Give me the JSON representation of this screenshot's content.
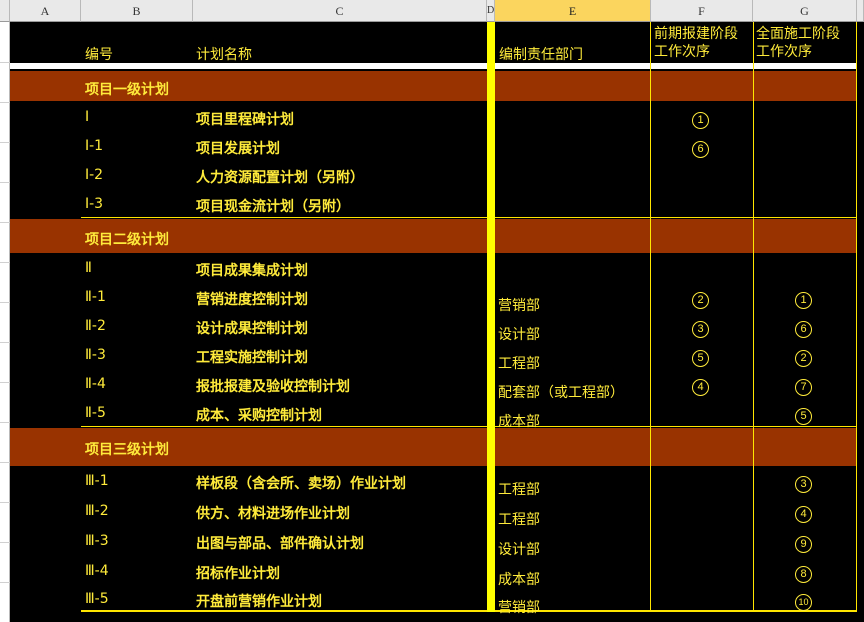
{
  "columns": [
    "A",
    "B",
    "C",
    "D",
    "E",
    "F",
    "G"
  ],
  "headers": {
    "num": "编号",
    "name": "计划名称",
    "dept": "编制责任部门",
    "phase1_line1": "前期报建阶段",
    "phase1_line2": "工作次序",
    "phase2_line1": "全面施工阶段",
    "phase2_line2": "工作次序"
  },
  "sections": [
    {
      "title": "项目一级计划"
    },
    {
      "title": "项目二级计划"
    },
    {
      "title": "项目三级计划"
    }
  ],
  "rows": [
    {
      "num": "Ⅰ",
      "name": "项目里程碑计划",
      "dept": "",
      "f": "1",
      "g": ""
    },
    {
      "num": "Ⅰ-1",
      "name": "项目发展计划",
      "dept": "",
      "f": "6",
      "g": ""
    },
    {
      "num": "Ⅰ-2",
      "name": "人力资源配置计划（另附）",
      "dept": "",
      "f": "",
      "g": ""
    },
    {
      "num": "Ⅰ-3",
      "name": "项目现金流计划（另附）",
      "dept": "",
      "f": "",
      "g": ""
    },
    {
      "num": "Ⅱ",
      "name": "项目成果集成计划",
      "dept": "",
      "f": "",
      "g": ""
    },
    {
      "num": "Ⅱ-1",
      "name": "营销进度控制计划",
      "dept": "营销部",
      "f": "2",
      "g": "1"
    },
    {
      "num": "Ⅱ-2",
      "name": "设计成果控制计划",
      "dept": "设计部",
      "f": "3",
      "g": "6"
    },
    {
      "num": "Ⅱ-3",
      "name": "工程实施控制计划",
      "dept": "工程部",
      "f": "5",
      "g": "2"
    },
    {
      "num": "Ⅱ-4",
      "name": "报批报建及验收控制计划",
      "dept": "配套部（或工程部）",
      "f": "4",
      "g": "7"
    },
    {
      "num": "Ⅱ-5",
      "name": "成本、采购控制计划",
      "dept": "成本部",
      "f": "",
      "g": "5"
    },
    {
      "num": "Ⅲ-1",
      "name": "样板段（含会所、卖场）作业计划",
      "dept": "工程部",
      "f": "",
      "g": "3"
    },
    {
      "num": "Ⅲ-2",
      "name": "供方、材料进场作业计划",
      "dept": "工程部",
      "f": "",
      "g": "4"
    },
    {
      "num": "Ⅲ-3",
      "name": "出图与部品、部件确认计划",
      "dept": "设计部",
      "f": "",
      "g": "9"
    },
    {
      "num": "Ⅲ-4",
      "name": "招标作业计划",
      "dept": "成本部",
      "f": "",
      "g": "8"
    },
    {
      "num": "Ⅲ-5",
      "name": "开盘前营销作业计划",
      "dept": "营销部",
      "f": "",
      "g": "10"
    }
  ],
  "colors": {
    "band": "#993300",
    "text": "#ffeb3b",
    "highlight": "#ffff00",
    "background": "#000000"
  }
}
